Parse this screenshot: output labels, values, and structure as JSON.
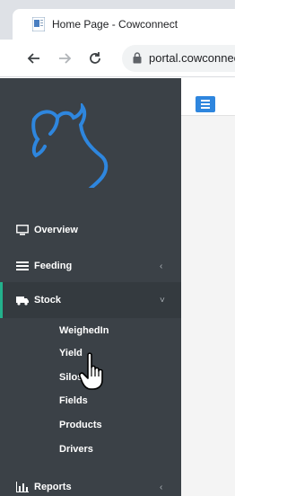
{
  "browser": {
    "tab_title": "Home Page - Cowconnect",
    "url": "portal.cowconnect.co.nz"
  },
  "sidebar": {
    "items": [
      {
        "label": "Overview",
        "icon": "monitor-icon"
      },
      {
        "label": "Feeding",
        "icon": "list-icon",
        "chevron": "‹"
      },
      {
        "label": "Stock",
        "icon": "truck-icon",
        "chevron": "˅"
      },
      {
        "label": "Reports",
        "icon": "bar-chart-icon",
        "chevron": "‹"
      }
    ],
    "stock_subitems": [
      "WeighedIn",
      "Yield",
      "Silos",
      "Fields",
      "Products",
      "Drivers"
    ]
  },
  "colors": {
    "sidebar_bg": "#3b4147",
    "active_accent": "#23b18c",
    "brand_blue": "#2e86de"
  }
}
